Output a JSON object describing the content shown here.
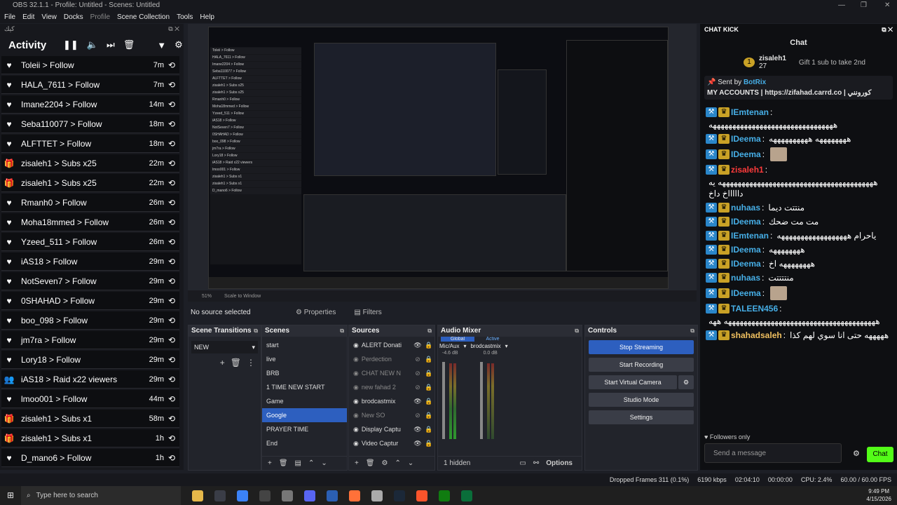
{
  "window": {
    "title": "OBS 32.1.1 - Profile: Untitled - Scenes: Untitled"
  },
  "menu": [
    "File",
    "Edit",
    "View",
    "Docks",
    "Profile",
    "Scene Collection",
    "Tools",
    "Help"
  ],
  "activity": {
    "dock_label": "كيك",
    "title": "Activity",
    "items": [
      {
        "icon": "heart",
        "text": "Toleii > Follow",
        "time": "7m"
      },
      {
        "icon": "heart",
        "text": "HALA_7611 > Follow",
        "time": "7m"
      },
      {
        "icon": "heart",
        "text": "Imane2204 > Follow",
        "time": "14m"
      },
      {
        "icon": "heart",
        "text": "Seba110077 > Follow",
        "time": "18m"
      },
      {
        "icon": "heart",
        "text": "ALFTTET > Follow",
        "time": "18m"
      },
      {
        "icon": "gift",
        "text": "zisaleh1 > Subs x25",
        "time": "22m"
      },
      {
        "icon": "gift",
        "text": "zisaleh1 > Subs x25",
        "time": "22m"
      },
      {
        "icon": "heart",
        "text": "Rmanh0 > Follow",
        "time": "26m"
      },
      {
        "icon": "heart",
        "text": "Moha18mmed > Follow",
        "time": "26m"
      },
      {
        "icon": "heart",
        "text": "Yzeed_511 > Follow",
        "time": "26m"
      },
      {
        "icon": "heart",
        "text": "iAS18 > Follow",
        "time": "29m"
      },
      {
        "icon": "heart",
        "text": "NotSeven7 > Follow",
        "time": "29m"
      },
      {
        "icon": "heart",
        "text": "0SHAHAD > Follow",
        "time": "29m"
      },
      {
        "icon": "heart",
        "text": "boo_098 > Follow",
        "time": "29m"
      },
      {
        "icon": "heart",
        "text": "jm7ra > Follow",
        "time": "29m"
      },
      {
        "icon": "heart",
        "text": "Lory18 > Follow",
        "time": "29m"
      },
      {
        "icon": "raid",
        "text": "iAS18 > Raid x22 viewers",
        "time": "29m"
      },
      {
        "icon": "heart",
        "text": "lmoo001 > Follow",
        "time": "44m"
      },
      {
        "icon": "gift",
        "text": "zisaleh1 > Subs x1",
        "time": "58m"
      },
      {
        "icon": "gift",
        "text": "zisaleh1 > Subs x1",
        "time": "1h"
      },
      {
        "icon": "heart",
        "text": "D_mano6 > Follow",
        "time": "1h"
      }
    ]
  },
  "preview": {
    "zoom": "51%",
    "scale": "Scale to Window",
    "no_source": "No source selected",
    "properties": "Properties",
    "filters": "Filters"
  },
  "transitions": {
    "title": "Scene Transitions",
    "selected": "NEW"
  },
  "scenes": {
    "title": "Scenes",
    "items": [
      "start",
      "live",
      "BRB",
      "1 TIME NEW START",
      "Game",
      "Google",
      "PRAYER TIME",
      "End"
    ],
    "selected": 5
  },
  "sources": {
    "title": "Sources",
    "items": [
      {
        "name": "ALERT Donati",
        "dim": false
      },
      {
        "name": "Perdection",
        "dim": true
      },
      {
        "name": "CHAT NEW N",
        "dim": true
      },
      {
        "name": "new fahad 2",
        "dim": true
      },
      {
        "name": "brodcastmix",
        "dim": false
      },
      {
        "name": "New SO",
        "dim": true
      },
      {
        "name": "Display Captu",
        "dim": false
      },
      {
        "name": "Video Captur",
        "dim": false
      }
    ]
  },
  "mixer": {
    "title": "Audio Mixer",
    "tab_global": "Global",
    "tab_active": "Active",
    "ch1": "Mic/Aux",
    "ch2": "brodcastmix",
    "db1": "-4.6 dB",
    "db2": "0.0 dB",
    "hidden": "1 hidden",
    "options": "Options"
  },
  "controls": {
    "title": "Controls",
    "stop": "Stop Streaming",
    "record": "Start Recording",
    "vcam": "Start Virtual Camera",
    "studio": "Studio Mode",
    "settings": "Settings"
  },
  "chat": {
    "title": "CHAT KICK",
    "header": "Chat",
    "gifter": {
      "name": "zisaleh1",
      "count": "27",
      "gift_text": "Gift 1 sub to take 2nd"
    },
    "pinned": {
      "sent_by": "Sent by",
      "bot": "BotRix",
      "text": "MY ACCOUNTS | https://zifahad.carrd.co | كورونني"
    },
    "messages": [
      {
        "user": "IEmtenan",
        "msg": "ههههههههههههههههههههههههههههههههه"
      },
      {
        "user": "IDeema",
        "msg": "ههههههههه ههههههههههه"
      },
      {
        "user": "IDeema",
        "msg": ""
      },
      {
        "user": "zisaleh1",
        "msg": "ههههههههههههههههههههههههههههههههههههههههه يه داااااخ داخ"
      },
      {
        "user": "nuhaas",
        "msg": "منتتت ديما"
      },
      {
        "user": "IDeema",
        "msg": "مت مت ضحك"
      },
      {
        "user": "IEmtenan",
        "msg": "ياحرام ههههههههههههههههههه"
      },
      {
        "user": "IDeema",
        "msg": "ههههههههه"
      },
      {
        "user": "IDeema",
        "msg": "ههههههههه اخ"
      },
      {
        "user": "nuhaas",
        "msg": "منتتتتت"
      },
      {
        "user": "IDeema",
        "msg": ""
      },
      {
        "user": "TALEEN456",
        "msg": "هههههههههههههههههههههههههههههههههههههههه ههه"
      },
      {
        "user": "shahadsaleh",
        "msg": "هههههه حتى انا سوي لهم كذا"
      }
    ],
    "followers_only": "Followers only",
    "placeholder": "Send a message",
    "send": "Chat"
  },
  "status": {
    "dropped": "Dropped Frames 311 (0.1%)",
    "kbps": "6190 kbps",
    "live": "02:04:10",
    "rec": "00:00:00",
    "cpu": "CPU: 2.4%",
    "fps": "60.00 / 60.00 FPS"
  },
  "taskbar": {
    "search": "Type here to search",
    "time": "9:49 PM",
    "date": "4/15/2026"
  }
}
